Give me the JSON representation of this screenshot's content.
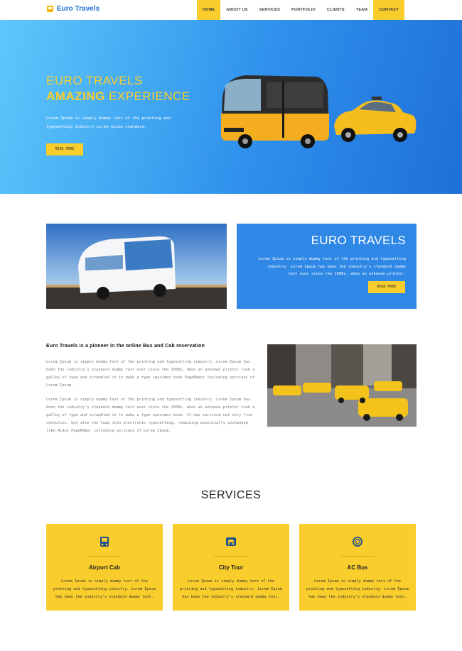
{
  "nav": {
    "brand": "Euro Travels",
    "items": [
      {
        "label": "HOME",
        "active": true
      },
      {
        "label": "ABOUT US",
        "active": false
      },
      {
        "label": "SERVICES",
        "active": false
      },
      {
        "label": "PORTFOLIO",
        "active": false
      },
      {
        "label": "CLIENTS",
        "active": false
      },
      {
        "label": "TEAM",
        "active": false
      },
      {
        "label": "CONTACT",
        "active": true
      }
    ]
  },
  "hero": {
    "title_line1": "EURO TRAVELS",
    "title_line2_bold": "AMAZING",
    "title_line2_rest": " EXPERIENCE",
    "text": "Lorem Ipsum is simply dummy text of the printing and typesetting industry Lorem Ipsum standard.",
    "button": "READ MORE"
  },
  "intro": {
    "title": "EURO TRAVELS",
    "text": "Lorem Ipsum is simply dummy text of the printing and typesetting industry. Lorem Ipsum has been the industry's standard dummy text ever since the 1500s, when an unknown printer.",
    "button": "READ MORE"
  },
  "about": {
    "heading": "Euro Travels is a pioneer in the online Bus and Cab reservation",
    "p1": "Lorem Ipsum is simply dummy text of the printing and typesetting industry. Lorem Ipsum has been the industry's standard dummy text ever since the 1500s, when an unknown printer took a galley of type and scrambled it to make a type specimen book PageMaker including versions of Lorem Ipsum.",
    "p2": "Lorem Ipsum is simply dummy text of the printing and typesetting industry. Lorem Ipsum has been the industry's standard dummy text ever since the 1500s, when an unknown printer took a galley of type and scrambled it to make a type specimen book. It has survived not only five centuries, but also the leap into electronic typesetting, remaining essentially unchanged like Aldus PageMaker including versions of Lorem Ipsum."
  },
  "services": {
    "title": "SERVICES",
    "items": [
      {
        "name": "Airport Cab",
        "icon": "cab-icon",
        "text": "Lorem Ipsum is simply dummy text of the printing and typesetting industry. Lorem Ipsum has been the industry's standard dummy text."
      },
      {
        "name": "City Tour",
        "icon": "car-icon",
        "text": "Lorem Ipsum is simply dummy text of the printing and typesetting industry. Lorem Ipsum has been the industry's standard dummy text."
      },
      {
        "name": "AC Bus",
        "icon": "fan-icon",
        "text": "Lorem Ipsum is simply dummy text of the printing and typesetting industry. Lorem Ipsum has been the industry's standard dummy text."
      }
    ]
  },
  "colors": {
    "accent": "#f9cd2b",
    "blue": "#2f88e6",
    "brand_text": "#1f6fd6"
  }
}
